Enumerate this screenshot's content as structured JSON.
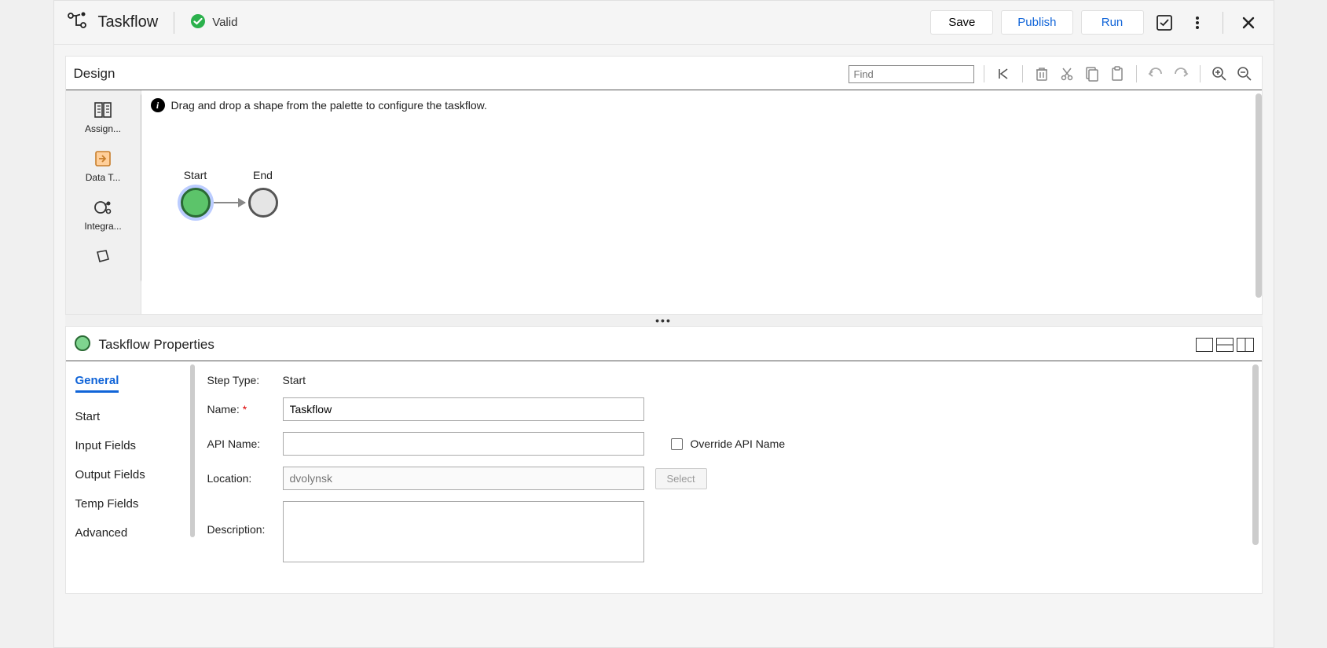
{
  "header": {
    "title": "Taskflow",
    "valid_label": "Valid",
    "save_label": "Save",
    "publish_label": "Publish",
    "run_label": "Run"
  },
  "design": {
    "title": "Design",
    "find_placeholder": "Find",
    "hint": "Drag and drop a shape from the palette to configure the taskflow.",
    "palette": [
      {
        "label": "Assign..."
      },
      {
        "label": "Data T..."
      },
      {
        "label": "Integra..."
      },
      {
        "label": ""
      }
    ],
    "nodes": {
      "start": "Start",
      "end": "End"
    }
  },
  "props": {
    "title": "Taskflow Properties",
    "tabs": [
      {
        "label": "General",
        "active": true
      },
      {
        "label": "Start"
      },
      {
        "label": "Input Fields"
      },
      {
        "label": "Output Fields"
      },
      {
        "label": "Temp Fields"
      },
      {
        "label": "Advanced"
      }
    ],
    "form": {
      "step_type_label": "Step Type:",
      "step_type_value": "Start",
      "name_label": "Name:",
      "name_value": "Taskflow",
      "api_name_label": "API Name:",
      "api_name_value": "",
      "override_label": "Override API Name",
      "location_label": "Location:",
      "location_placeholder": "dvolynsk",
      "select_label": "Select",
      "description_label": "Description:",
      "description_value": ""
    }
  }
}
